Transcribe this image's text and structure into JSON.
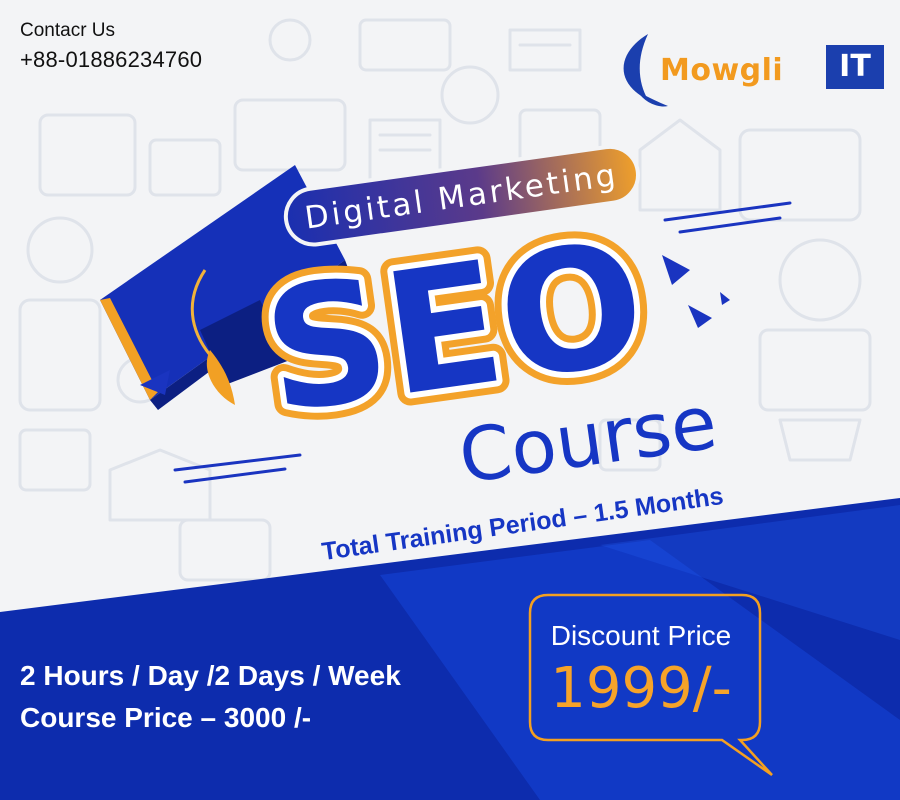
{
  "contact": {
    "label": "Contacr Us",
    "phone": "+88-01886234760"
  },
  "brand": {
    "name": "Mowgli",
    "suffix": "IT",
    "primary": "#1b3fae",
    "accent": "#f29a1f"
  },
  "headline": {
    "subtitle": "Digital Marketing",
    "title": "SEO",
    "course": "Course",
    "period": "Total Training Period – 1.5 Months"
  },
  "offer": {
    "schedule": "2 Hours / Day /2 Days / Week",
    "course_price": "Course Price – 3000 /-",
    "discount_label": "Discount Price",
    "discount_value": "1999/-"
  },
  "colors": {
    "blue": "#1030b7",
    "blue_dark": "#0a1f8d",
    "orange": "#f4a021",
    "text_dark": "#111111"
  }
}
